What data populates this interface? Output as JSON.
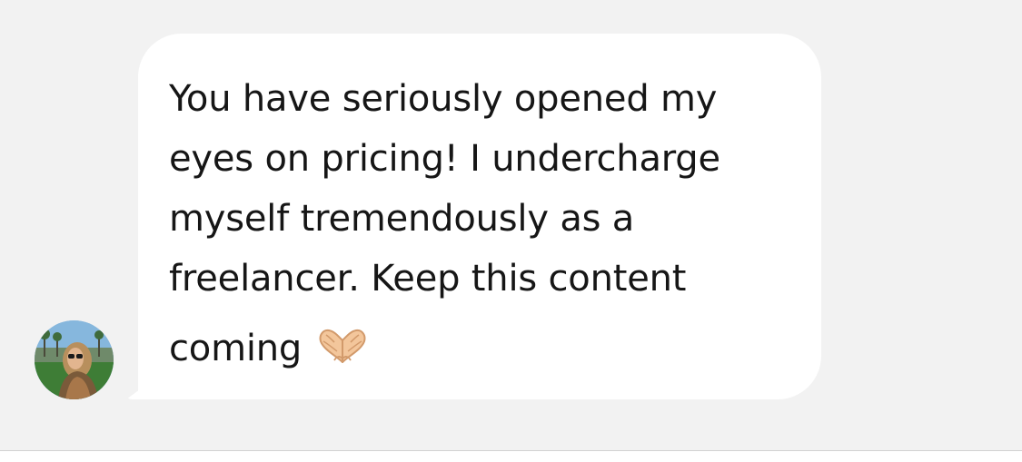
{
  "message": {
    "lines": [
      "You have seriously opened my",
      "eyes on pricing! I undercharge",
      "myself tremendously as a",
      "freelancer. Keep this content",
      "coming"
    ],
    "emoji": "heart-hands-emoji"
  },
  "avatar": {
    "icon": "profile-photo-avatar"
  },
  "colors": {
    "background": "#f2f2f2",
    "bubble": "#ffffff",
    "text": "#161616"
  }
}
